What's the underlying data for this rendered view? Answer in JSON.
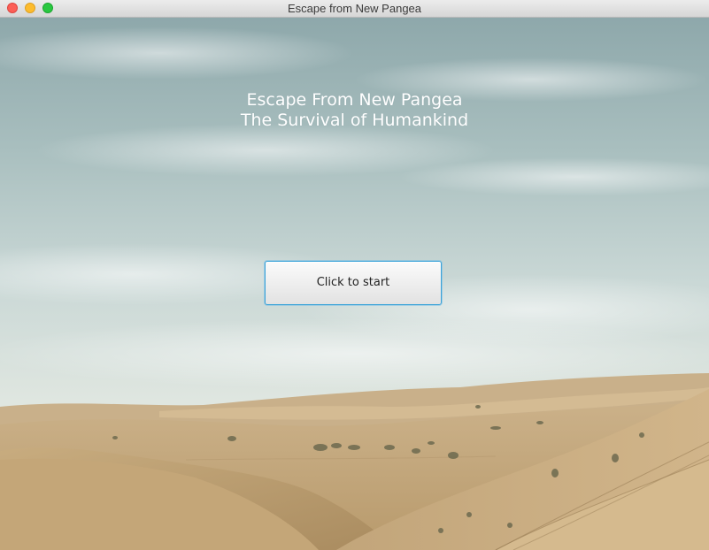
{
  "window": {
    "title": "Escape from New Pangea"
  },
  "headline": {
    "line1": "Escape From New Pangea",
    "line2": "The Survival of Humankind"
  },
  "start": {
    "label": "Click to start"
  },
  "colors": {
    "button_focus_border": "#39a2d8",
    "sky_top": "#8fa9ac",
    "sand": "#c9ad80"
  }
}
